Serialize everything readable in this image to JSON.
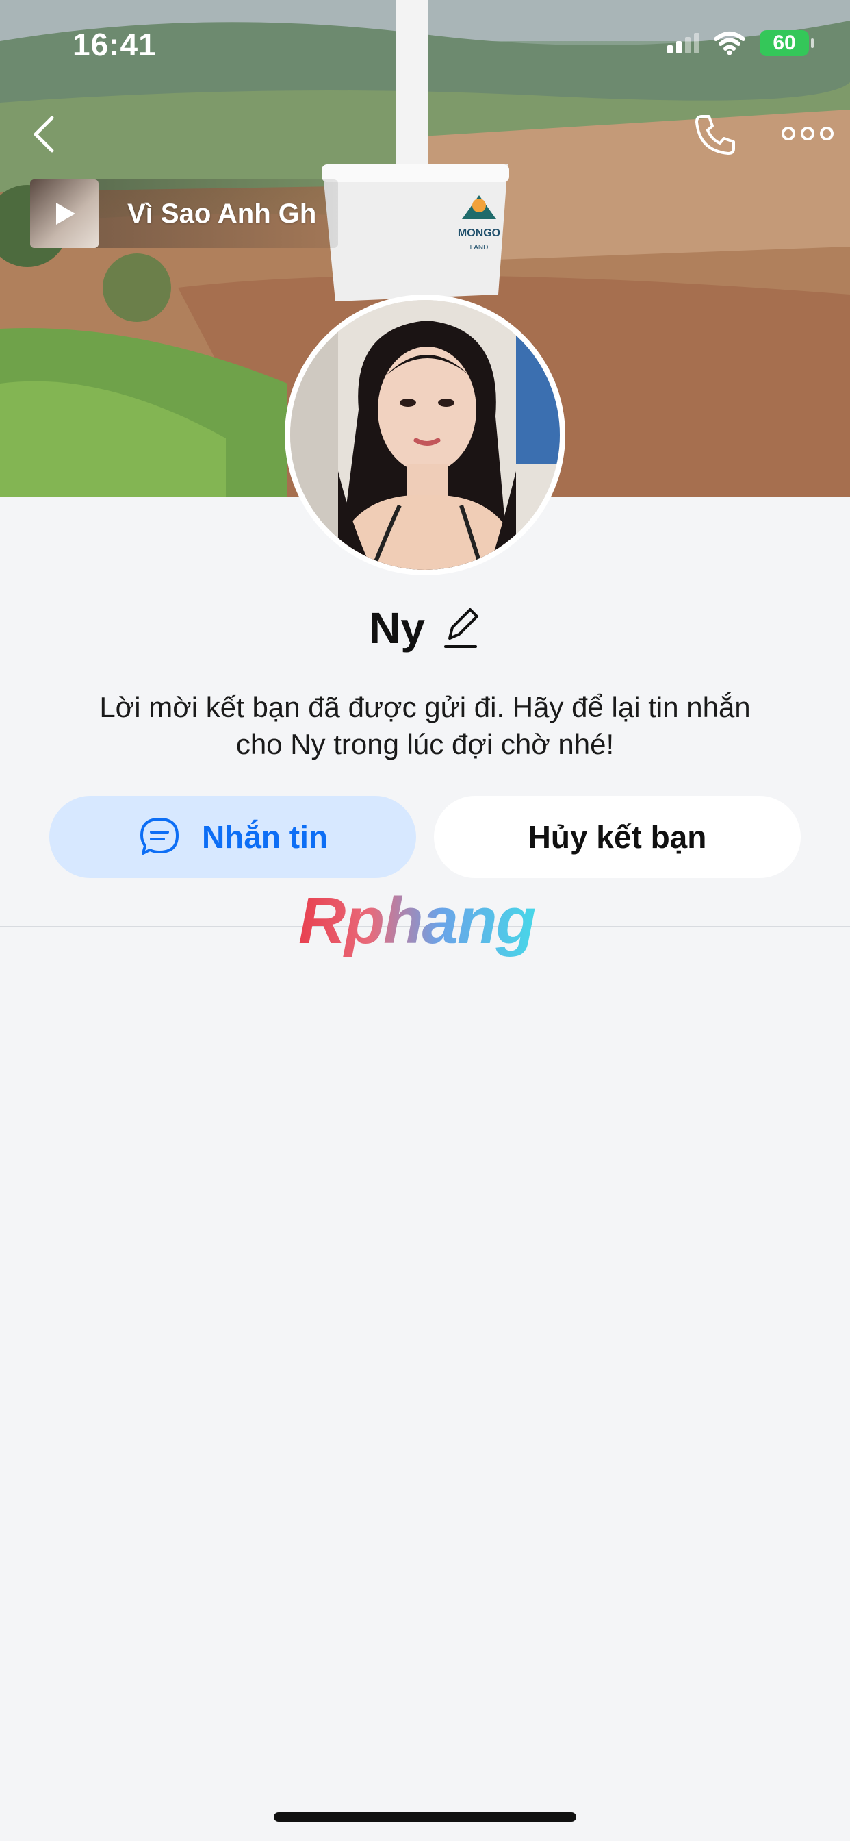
{
  "status_bar": {
    "time": "16:41",
    "battery": "60"
  },
  "cover": {
    "cup_brand": "MONGO",
    "cup_sub": "LAND"
  },
  "music": {
    "title": "Vì Sao Anh Gh"
  },
  "profile": {
    "name": "Ny",
    "notice_line1": "Lời mời kết bạn đã được gửi đi. Hãy để lại tin nhắn",
    "notice_line2": "cho Ny trong lúc đợi chờ nhé!"
  },
  "actions": {
    "message_label": "Nhắn tin",
    "cancel_label": "Hủy kết bạn"
  },
  "watermark": "Rphang",
  "colors": {
    "accent": "#0d6ef5",
    "accent_bg": "#d7e8ff",
    "page_bg": "#f4f5f7",
    "battery": "#34c759"
  },
  "icons": [
    "back-icon",
    "phone-icon",
    "more-icon",
    "play-icon",
    "edit-icon",
    "message-icon",
    "signal-icon",
    "wifi-icon",
    "battery-icon"
  ]
}
